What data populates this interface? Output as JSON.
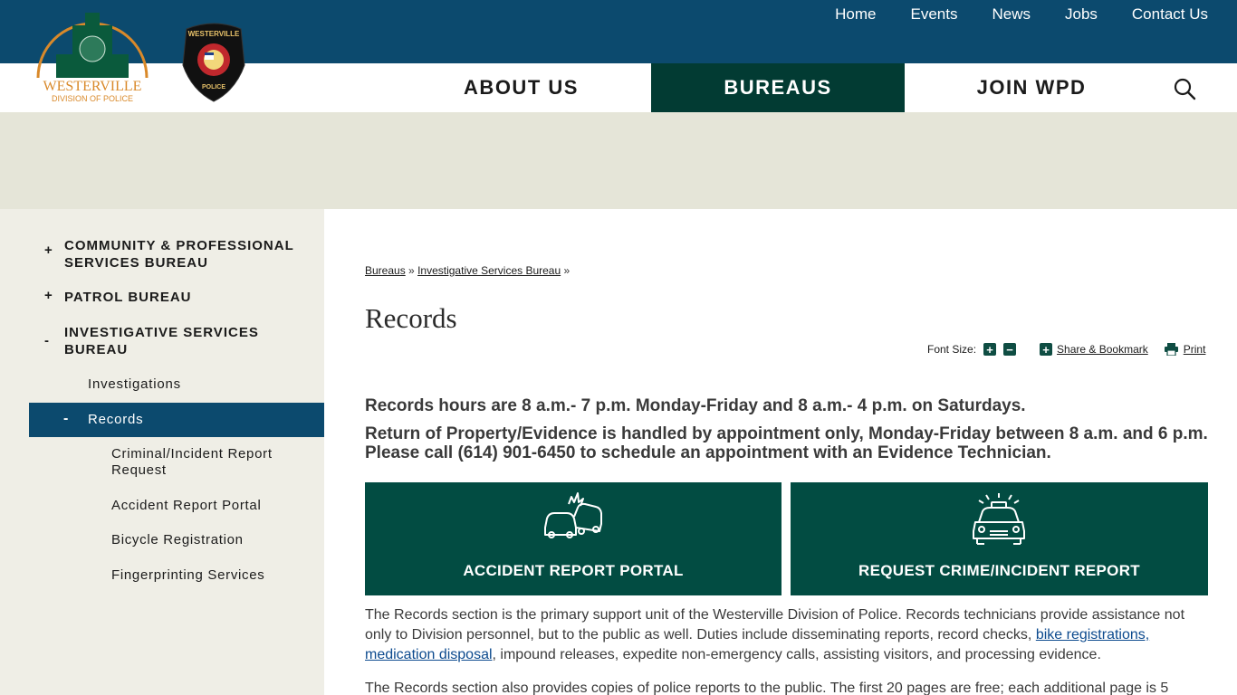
{
  "utility_nav": [
    "Home",
    "Events",
    "News",
    "Jobs",
    "Contact Us"
  ],
  "main_nav": {
    "about": "ABOUT US",
    "bureaus": "BUREAUS",
    "join": "JOIN WPD"
  },
  "logo": {
    "line1": "WESTERVILLE",
    "line2": "DIVISION OF POLICE"
  },
  "badge": {
    "top": "WESTERVILLE",
    "bottom": "POLICE"
  },
  "sidebar": {
    "items": [
      {
        "toggle": "+",
        "label": "COMMUNITY & PROFESSIONAL SERVICES BUREAU"
      },
      {
        "toggle": "+",
        "label": "PATROL BUREAU"
      },
      {
        "toggle": "-",
        "label": "INVESTIGATIVE SERVICES BUREAU"
      }
    ],
    "sub": {
      "investigations": "Investigations",
      "records": "Records",
      "records_toggle": "-"
    },
    "subsub": [
      "Criminal/Incident Report Request",
      "Accident Report Portal",
      "Bicycle Registration",
      "Fingerprinting Services"
    ]
  },
  "breadcrumb": {
    "link1": "Bureaus",
    "sep": "»",
    "link2": "Investigative Services Bureau"
  },
  "page_title": "Records",
  "tools": {
    "font_size": "Font Size:",
    "plus": "+",
    "minus": "−",
    "share": "Share & Bookmark",
    "print": "Print"
  },
  "notice": {
    "hours": "Records hours are 8 a.m.- 7 p.m. Monday-Friday and 8 a.m.- 4 p.m. on Saturdays.",
    "property": "Return of Property/Evidence is handled by appointment only, Monday-Friday between 8 a.m. and 6 p.m. Please call (614) 901-6450 to schedule an appointment with an Evidence Technician."
  },
  "tiles": {
    "accident": "ACCIDENT REPORT PORTAL",
    "crime": "REQUEST CRIME/INCIDENT REPORT"
  },
  "para1": {
    "before": "The Records section is the primary support unit of the Westerville Division of Police. Records technicians provide assistance not only to Division personnel, but to the public as well. Duties include disseminating reports, record checks, ",
    "link1": "bike registrations,",
    "link2": "medication disposal",
    "after": ", impound releases, expedite non-emergency calls, assisting visitors, and processing evidence."
  },
  "para2": "The Records section also provides copies of police reports to the public. The first 20 pages are free; each additional page is 5",
  "colors": {
    "topbar": "#0c4a6e",
    "bureaus_active": "#023b33",
    "tile": "#024c42",
    "banner": "#e5e5d8",
    "sidebar": "#efeee6"
  }
}
